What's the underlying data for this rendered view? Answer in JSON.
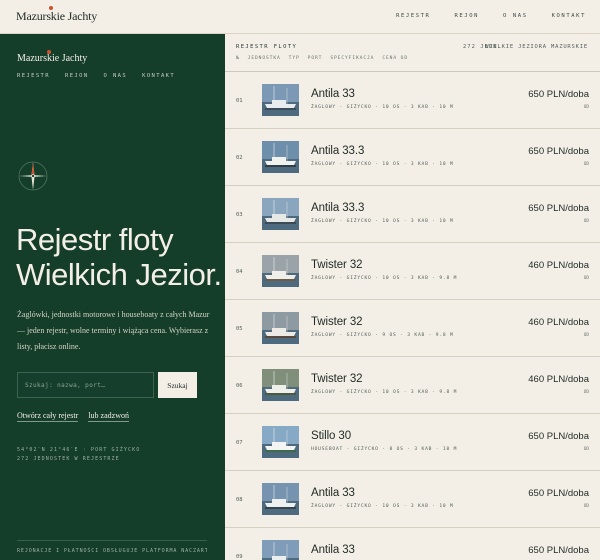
{
  "brand": "Mazurskie Jachty",
  "topnav": [
    "REJESTR",
    "REJON",
    "O NAS",
    "KONTAKT"
  ],
  "left": {
    "nav": [
      "REJESTR",
      "REJON",
      "O NAS",
      "KONTAKT"
    ],
    "hero_line1": "Rejestr floty",
    "hero_line2": "Wielkich Jezior.",
    "lead": "Żaglówki, jednostki motorowe i houseboaty z całych Mazur — jeden rejestr, wolne terminy i wiążąca cena. Wybierasz z listy, płacisz online.",
    "search_placeholder": "Szukaj: nazwa, port…",
    "search_button": "Szukaj",
    "link_register": "Otwórz cały rejestr",
    "link_call": "lub zadzwoń",
    "coords_line1": "54°02′N 21°46′E · PORT GIŻYCKO",
    "coords_line2": "272 JEDNOSTEK W REJESTRZE",
    "footer": "REJONACJE I PŁATNOŚCI OBSŁUGUJE PLATFORMA NACZARTER.PL"
  },
  "list": {
    "title": "REJESTR FLOTY",
    "count": "272 JEDN.",
    "region": "WIELKIE JEZIORA MAZURSKIE",
    "columns": [
      "№",
      "JEDNOSTKA",
      "TYP",
      "PORT",
      "SPECYFIKACJA",
      "CENA OD"
    ],
    "rows": [
      {
        "num": "01",
        "name": "Antila 33",
        "meta": "ŻAGLOWY · GIŻYCKO · 10 OS · 3 KAB · 10 M",
        "price": "650 PLN/doba",
        "tiny": "OD"
      },
      {
        "num": "02",
        "name": "Antila 33.3",
        "meta": "ŻAGLOWY · GIŻYCKO · 10 OS · 3 KAB · 10 M",
        "price": "650 PLN/doba",
        "tiny": "OD"
      },
      {
        "num": "03",
        "name": "Antila 33.3",
        "meta": "ŻAGLOWY · GIŻYCKO · 10 OS · 3 KAB · 10 M",
        "price": "650 PLN/doba",
        "tiny": "OD"
      },
      {
        "num": "04",
        "name": "Twister 32",
        "meta": "ŻAGLOWY · GIŻYCKO · 10 OS · 3 KAB · 9.8 M",
        "price": "460 PLN/doba",
        "tiny": "OD"
      },
      {
        "num": "05",
        "name": "Twister 32",
        "meta": "ŻAGLOWY · GIŻYCKO · 9 OS · 3 KAB · 9.8 M",
        "price": "460 PLN/doba",
        "tiny": "OD"
      },
      {
        "num": "06",
        "name": "Twister 32",
        "meta": "ŻAGLOWY · GIŻYCKO · 10 OS · 3 KAB · 9.8 M",
        "price": "460 PLN/doba",
        "tiny": "OD"
      },
      {
        "num": "07",
        "name": "Stillo 30",
        "meta": "HOUSEBOAT · GIŻYCKO · 8 OS · 3 KAB · 10 M",
        "price": "650 PLN/doba",
        "tiny": "OD"
      },
      {
        "num": "08",
        "name": "Antila 33",
        "meta": "ŻAGLOWY · GIŻYCKO · 10 OS · 3 KAB · 10 M",
        "price": "650 PLN/doba",
        "tiny": "OD"
      },
      {
        "num": "09",
        "name": "Antila 33",
        "meta": "ŻAGLOWY · GIŻYCKO · 10 OS · 3 KAB · 10 M",
        "price": "650 PLN/doba",
        "tiny": "OD"
      }
    ]
  },
  "colors": {
    "panel": "#143d2a",
    "paper": "#f3efe6",
    "accent": "#c9522f"
  }
}
